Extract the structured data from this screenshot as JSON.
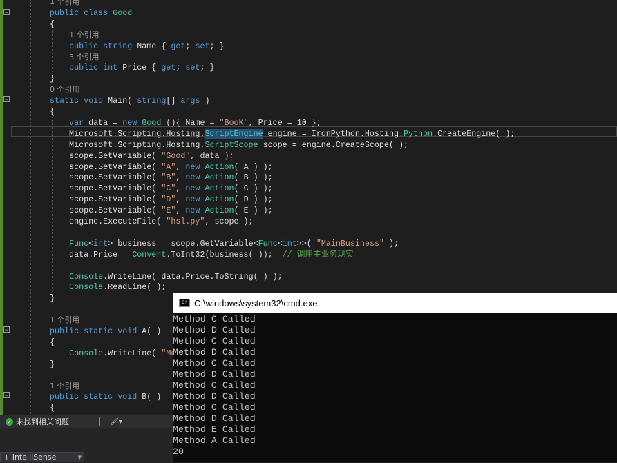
{
  "editor": {
    "lines": [
      [
        [
          "1 个引用",
          "r"
        ]
      ],
      [
        [
          "public class ",
          "k"
        ],
        [
          "Good",
          "t"
        ]
      ],
      [
        [
          "{",
          "n"
        ]
      ],
      [
        [
          "    ",
          "n"
        ],
        [
          "1 个引用",
          "r"
        ]
      ],
      [
        [
          "    public string ",
          "k"
        ],
        [
          "Name { ",
          "n"
        ],
        [
          "get",
          "k"
        ],
        [
          "; ",
          "n"
        ],
        [
          "set",
          "k"
        ],
        [
          "; }",
          "n"
        ]
      ],
      [
        [
          "    ",
          "n"
        ],
        [
          "3 个引用",
          "r"
        ]
      ],
      [
        [
          "    public int ",
          "k"
        ],
        [
          "Price { ",
          "n"
        ],
        [
          "get",
          "k"
        ],
        [
          "; ",
          "n"
        ],
        [
          "set",
          "k"
        ],
        [
          "; }",
          "n"
        ]
      ],
      [
        [
          "}",
          "n"
        ]
      ],
      [
        [
          "0 个引用",
          "r"
        ]
      ],
      [
        [
          "static void ",
          "k"
        ],
        [
          "Main( ",
          "n"
        ],
        [
          "string",
          "k"
        ],
        [
          "[] ",
          "n"
        ],
        [
          "args",
          "k"
        ],
        [
          " )",
          "n"
        ]
      ],
      [
        [
          "{",
          "n"
        ]
      ],
      [
        [
          "    var ",
          "k"
        ],
        [
          "data = ",
          "n"
        ],
        [
          "new ",
          "k"
        ],
        [
          "Good",
          "t"
        ],
        [
          " (){ Name = ",
          "n"
        ],
        [
          "\"BooK\"",
          "s"
        ],
        [
          ", Price = 10 };",
          "n"
        ]
      ],
      [
        [
          "    Microsoft.Scripting.Hosting.",
          "n"
        ],
        [
          "ScriptEngine",
          "t hl"
        ],
        [
          " engine = IronPython.Hosting.",
          "n"
        ],
        [
          "Python",
          "t"
        ],
        [
          ".CreateEngine( );",
          "n"
        ]
      ],
      [
        [
          "    Microsoft.Scripting.Hosting.",
          "n"
        ],
        [
          "ScriptScope",
          "t"
        ],
        [
          " scope = engine.CreateScope( );",
          "n"
        ]
      ],
      [
        [
          "    scope.SetVariable( ",
          "n"
        ],
        [
          "\"Good\"",
          "s"
        ],
        [
          ", data );",
          "n"
        ]
      ],
      [
        [
          "    scope.SetVariable( ",
          "n"
        ],
        [
          "\"A\"",
          "s"
        ],
        [
          ", ",
          "n"
        ],
        [
          "new ",
          "k"
        ],
        [
          "Action",
          "t"
        ],
        [
          "( A ) );",
          "n"
        ]
      ],
      [
        [
          "    scope.SetVariable( ",
          "n"
        ],
        [
          "\"B\"",
          "s"
        ],
        [
          ", ",
          "n"
        ],
        [
          "new ",
          "k"
        ],
        [
          "Action",
          "t"
        ],
        [
          "( B ) );",
          "n"
        ]
      ],
      [
        [
          "    scope.SetVariable( ",
          "n"
        ],
        [
          "\"C\"",
          "s"
        ],
        [
          ", ",
          "n"
        ],
        [
          "new ",
          "k"
        ],
        [
          "Action",
          "t"
        ],
        [
          "( C ) );",
          "n"
        ]
      ],
      [
        [
          "    scope.SetVariable( ",
          "n"
        ],
        [
          "\"D\"",
          "s"
        ],
        [
          ", ",
          "n"
        ],
        [
          "new ",
          "k"
        ],
        [
          "Action",
          "t"
        ],
        [
          "( D ) );",
          "n"
        ]
      ],
      [
        [
          "    scope.SetVariable( ",
          "n"
        ],
        [
          "\"E\"",
          "s"
        ],
        [
          ", ",
          "n"
        ],
        [
          "new ",
          "k"
        ],
        [
          "Action",
          "t"
        ],
        [
          "( E ) );",
          "n"
        ]
      ],
      [
        [
          "    engine.ExecuteFile( ",
          "n"
        ],
        [
          "\"hsl.py\"",
          "s"
        ],
        [
          ", scope );",
          "n"
        ]
      ],
      [],
      [
        [
          "    ",
          "n"
        ],
        [
          "Func",
          "t"
        ],
        [
          "<",
          "n"
        ],
        [
          "int",
          "k"
        ],
        [
          "> business = scope.GetVariable<",
          "n"
        ],
        [
          "Func",
          "t"
        ],
        [
          "<",
          "n"
        ],
        [
          "int",
          "k"
        ],
        [
          ">>( ",
          "n"
        ],
        [
          "\"MainBusiness\"",
          "s"
        ],
        [
          " );",
          "n"
        ]
      ],
      [
        [
          "    data.Price = ",
          "n"
        ],
        [
          "Convert",
          "t"
        ],
        [
          ".ToInt32(business( ));  ",
          "n"
        ],
        [
          "// 调用主业务现实",
          "c"
        ]
      ],
      [],
      [
        [
          "    ",
          "n"
        ],
        [
          "Console",
          "t"
        ],
        [
          ".WriteLine( data.Price.ToString( ) );",
          "n"
        ]
      ],
      [
        [
          "    ",
          "n"
        ],
        [
          "Console",
          "t"
        ],
        [
          ".ReadLine( );",
          "n"
        ]
      ],
      [
        [
          "}",
          "n"
        ]
      ],
      [],
      [
        [
          "1 个引用",
          "r"
        ]
      ],
      [
        [
          "public static void ",
          "k"
        ],
        [
          "A( )",
          "n"
        ]
      ],
      [
        [
          "{",
          "n"
        ]
      ],
      [
        [
          "    ",
          "n"
        ],
        [
          "Console",
          "t"
        ],
        [
          ".WriteLine( ",
          "n"
        ],
        [
          "\"Me",
          "s"
        ]
      ],
      [
        [
          "}",
          "n"
        ]
      ],
      [],
      [
        [
          "1 个引用",
          "r"
        ]
      ],
      [
        [
          "public static void ",
          "k"
        ],
        [
          "B( )",
          "n"
        ]
      ],
      [
        [
          "{",
          "n"
        ]
      ]
    ]
  },
  "console": {
    "title": "C:\\windows\\system32\\cmd.exe",
    "output": [
      "Method C Called",
      "Method D Called",
      "Method C Called",
      "Method D Called",
      "Method C Called",
      "Method D Called",
      "Method C Called",
      "Method D Called",
      "Method C Called",
      "Method D Called",
      "Method E Called",
      "Method A Called",
      "20"
    ]
  },
  "status": {
    "message": "未找到相关问题"
  },
  "errorlist": {
    "filter": "+ IntelliSense"
  }
}
